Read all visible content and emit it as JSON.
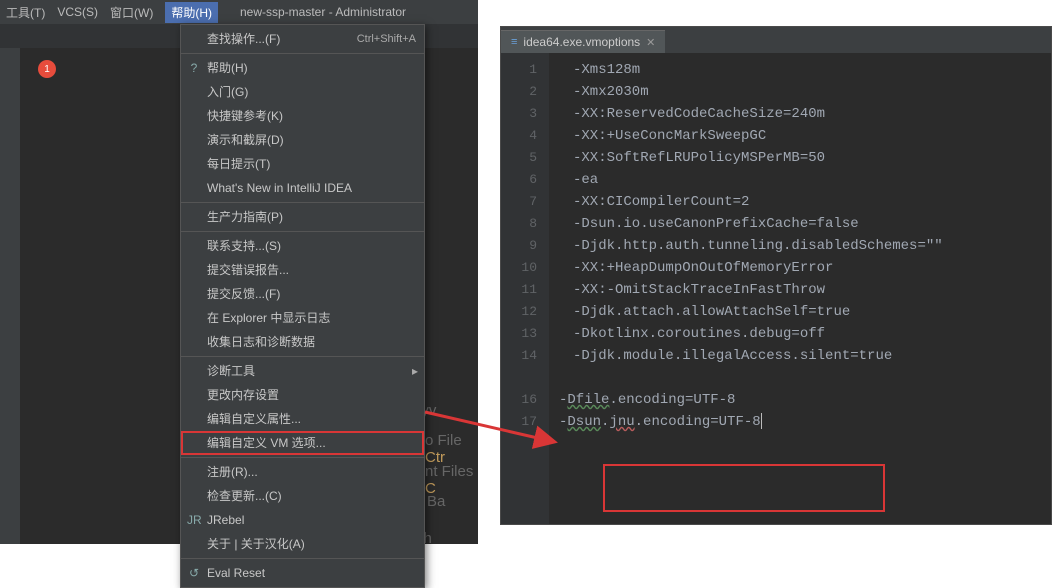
{
  "menubar": {
    "items": [
      "工具(T)",
      "VCS(S)",
      "窗口(W)",
      "帮助(H)"
    ],
    "title": "new-ssp-master - Administrator",
    "active_index": 3
  },
  "badge": "1",
  "dropdown": {
    "groups": [
      [
        {
          "label": "查找操作...(F)",
          "shortcut": "Ctrl+Shift+A"
        }
      ],
      [
        {
          "label": "帮助(H)",
          "icon": "?"
        },
        {
          "label": "入门(G)"
        },
        {
          "label": "快捷键参考(K)"
        },
        {
          "label": "演示和截屏(D)"
        },
        {
          "label": "每日提示(T)"
        },
        {
          "label": "What's New in IntelliJ IDEA"
        }
      ],
      [
        {
          "label": "生产力指南(P)"
        }
      ],
      [
        {
          "label": "联系支持...(S)"
        },
        {
          "label": "提交错误报告..."
        },
        {
          "label": "提交反馈...(F)"
        },
        {
          "label": "在 Explorer 中显示日志"
        },
        {
          "label": "收集日志和诊断数据"
        }
      ],
      [
        {
          "label": "诊断工具",
          "submenu": true
        },
        {
          "label": "更改内存设置"
        },
        {
          "label": "编辑自定义属性..."
        },
        {
          "label": "编辑自定义 VM 选项...",
          "highlight": true
        }
      ],
      [
        {
          "label": "注册(R)..."
        },
        {
          "label": "检查更新...(C)"
        },
        {
          "label": "JRebel",
          "icon": "JR"
        },
        {
          "label": "关于 | 关于汉化(A)"
        }
      ],
      [
        {
          "label": "Eval Reset",
          "icon": "↺"
        }
      ]
    ]
  },
  "background_text": {
    "l1a": "h Everyv",
    "l2a": "o File ",
    "l2b": "Ctr",
    "l3a": "nt Files ",
    "l3b": "C",
    "l4": "gation Ba",
    "l5": "Drop files h"
  },
  "editor": {
    "tab": {
      "icon": "≡",
      "name": "idea64.exe.vmoptions"
    },
    "lines": [
      {
        "n": 1,
        "t": "-Xms128m"
      },
      {
        "n": 2,
        "t": "-Xmx2030m"
      },
      {
        "n": 3,
        "t": "-XX:ReservedCodeCacheSize=240m"
      },
      {
        "n": 4,
        "t": "-XX:+UseConcMarkSweepGC"
      },
      {
        "n": 5,
        "t": "-XX:SoftRefLRUPolicyMSPerMB=50"
      },
      {
        "n": 6,
        "t": "-ea"
      },
      {
        "n": 7,
        "t": "-XX:CICompilerCount=2"
      },
      {
        "n": 8,
        "t": "-Dsun.io.useCanonPrefixCache=false"
      },
      {
        "n": 9,
        "t": "-Djdk.http.auth.tunneling.disabledSchemes=\"\""
      },
      {
        "n": 10,
        "t": "-XX:+HeapDumpOnOutOfMemoryError"
      },
      {
        "n": 11,
        "t": "-XX:-OmitStackTraceInFastThrow"
      },
      {
        "n": 12,
        "t": "-Djdk.attach.allowAttachSelf=true"
      },
      {
        "n": 13,
        "t": "-Dkotlinx.coroutines.debug=off"
      },
      {
        "n": 14,
        "t": "-Djdk.module.illegalAccess.silent=true"
      }
    ],
    "boxed_lines": [
      {
        "n": 16,
        "pre": "-",
        "mid": "Dfile",
        "post": ".encoding=UTF-8"
      },
      {
        "n": 17,
        "pre": "-",
        "mid1": "Dsun",
        "dot1": ".",
        "mid2": "jnu",
        "post": ".encoding=UTF-8"
      }
    ]
  }
}
